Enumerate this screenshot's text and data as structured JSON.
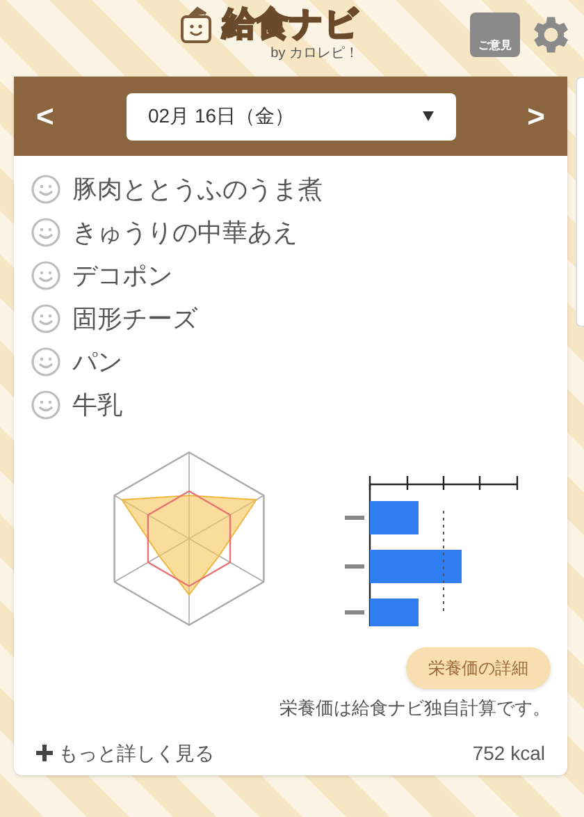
{
  "header": {
    "logo_text": "給食ナビ",
    "byline": "by カロレピ！",
    "feedback_label": "ご意見"
  },
  "date_bar": {
    "prev": "<",
    "next": ">",
    "date": "02月 16日（金）"
  },
  "menu_items": [
    {
      "name": "豚肉ととうふのうま煮"
    },
    {
      "name": "きゅうりの中華あえ"
    },
    {
      "name": "デコポン"
    },
    {
      "name": "固形チーズ"
    },
    {
      "name": "パン"
    },
    {
      "name": "牛乳"
    }
  ],
  "nutrition": {
    "detail_button": "栄養価の詳細",
    "note": "栄養価は給食ナビ独自計算です。",
    "more_link": "もっと詳しく見る",
    "calories": "752 kcal"
  }
}
